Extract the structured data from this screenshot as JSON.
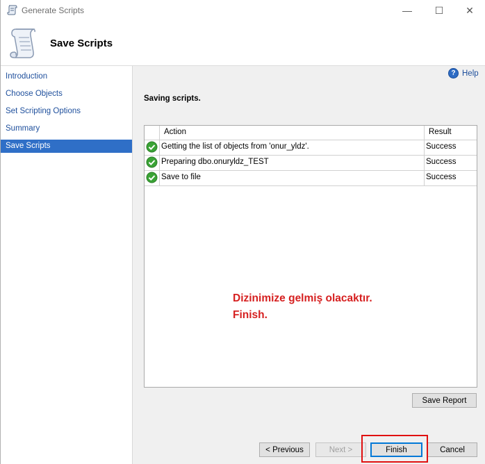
{
  "window": {
    "title": "Generate Scripts",
    "minimize_glyph": "—",
    "maximize_glyph": "☐",
    "close_glyph": "✕"
  },
  "header": {
    "title": "Save Scripts"
  },
  "sidebar": {
    "items": [
      {
        "label": "Introduction",
        "active": false
      },
      {
        "label": "Choose Objects",
        "active": false
      },
      {
        "label": "Set Scripting Options",
        "active": false
      },
      {
        "label": "Summary",
        "active": false
      },
      {
        "label": "Save Scripts",
        "active": true
      }
    ]
  },
  "help": {
    "label": "Help",
    "icon": "?"
  },
  "main": {
    "section_title": "Saving scripts.",
    "grid": {
      "columns": [
        "Action",
        "Result"
      ],
      "rows": [
        {
          "action": "Getting the list of objects from 'onur_yldz'.",
          "result": "Success",
          "status_icon": "success-check-icon"
        },
        {
          "action": "Preparing dbo.onuryldz_TEST",
          "result": "Success",
          "status_icon": "success-check-icon"
        },
        {
          "action": "Save to file",
          "result": "Success",
          "status_icon": "success-check-icon"
        }
      ]
    },
    "annotation": {
      "line1": "Dizinimize gelmiş olacaktır.",
      "line2": "Finish.",
      "color": "#d62020"
    },
    "save_report_label": "Save Report"
  },
  "footer": {
    "previous_label": "< Previous",
    "next_label": "Next >",
    "finish_label": "Finish",
    "cancel_label": "Cancel"
  },
  "colors": {
    "accent": "#2f6fc7",
    "link": "#1e4f9c",
    "success": "#3aa335",
    "highlight_box": "#e01010"
  }
}
